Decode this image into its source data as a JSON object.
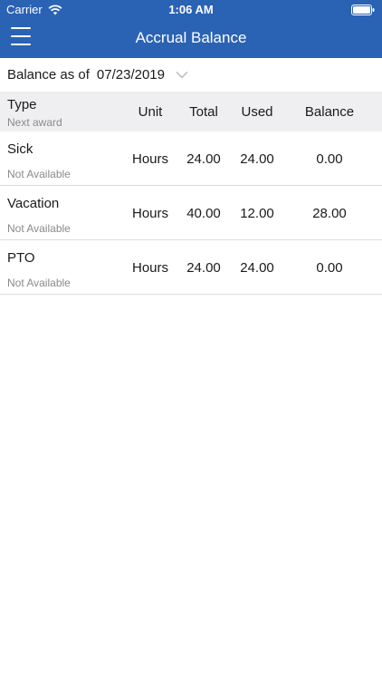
{
  "status_bar": {
    "carrier": "Carrier",
    "time": "1:06 AM"
  },
  "nav": {
    "title": "Accrual Balance",
    "menu_icon": "hamburger-menu-icon"
  },
  "balance_date": {
    "label": "Balance as of",
    "value": "07/23/2019",
    "dropdown_icon": "chevron-down-icon"
  },
  "table": {
    "headers": {
      "type": "Type",
      "type_sub": "Next award",
      "unit": "Unit",
      "total": "Total",
      "used": "Used",
      "balance": "Balance"
    },
    "rows": [
      {
        "type": "Sick",
        "next_award": "Not Available",
        "unit": "Hours",
        "total": "24.00",
        "used": "24.00",
        "balance": "0.00"
      },
      {
        "type": "Vacation",
        "next_award": "Not Available",
        "unit": "Hours",
        "total": "40.00",
        "used": "12.00",
        "balance": "28.00"
      },
      {
        "type": "PTO",
        "next_award": "Not Available",
        "unit": "Hours",
        "total": "24.00",
        "used": "24.00",
        "balance": "0.00"
      }
    ]
  },
  "colors": {
    "nav_background": "#2a62b4",
    "header_background": "#efeff2",
    "secondary_text": "#8a8a8e"
  }
}
